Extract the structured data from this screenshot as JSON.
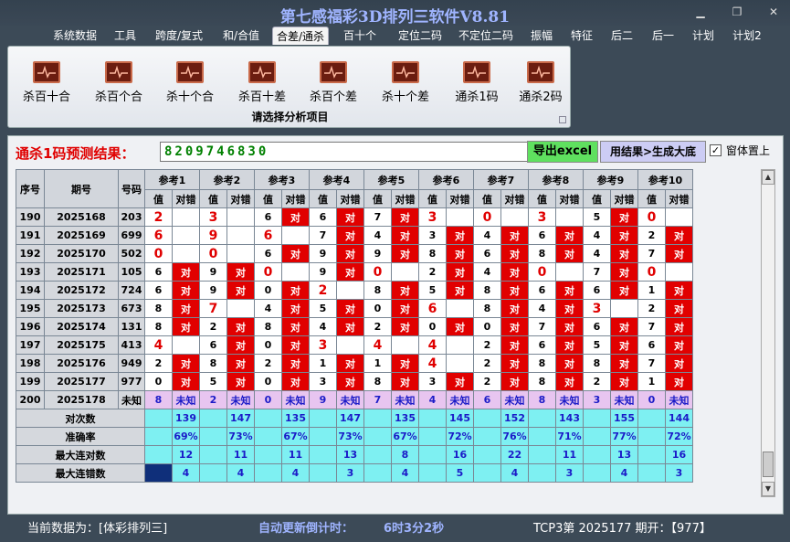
{
  "window": {
    "title": "第七感福彩3D排列三软件V8.81",
    "min": "▁",
    "max": "❐",
    "close": "✕"
  },
  "menu": [
    "系统数据",
    "工具",
    "跨度/复式",
    "和/合值",
    "合差/通杀",
    "百十个",
    "定位二码",
    "不定位二码",
    "振幅",
    "特征",
    "后二",
    "后一",
    "计划",
    "计划2"
  ],
  "menu_active": 4,
  "ribbon": {
    "items": [
      "杀百十合",
      "杀百个合",
      "杀十个合",
      "杀百十差",
      "杀百个差",
      "杀十个差",
      "通杀1码",
      "通杀2码"
    ],
    "caption": "请选择分析项目"
  },
  "prediction": {
    "label": "通杀1码预测结果：",
    "value": "8209746830",
    "excel_button": "导出excel",
    "generate_button": "用结果>生成大底",
    "ontop_label": "窗体置上",
    "ontop_checked": "✓"
  },
  "table": {
    "headers": {
      "seq": "序号",
      "period": "期号",
      "code": "号码",
      "refs": [
        "参考1",
        "参考2",
        "参考3",
        "参考4",
        "参考5",
        "参考6",
        "参考7",
        "参考8",
        "参考9",
        "参考10"
      ],
      "val": "值",
      "check": "对错"
    },
    "rows": [
      {
        "seq": "190",
        "period": "2025168",
        "code": "203",
        "vals": [
          "2",
          "3",
          "6",
          "6",
          "7",
          "3",
          "0",
          "3",
          "5",
          "0"
        ]
      },
      {
        "seq": "191",
        "period": "2025169",
        "code": "699",
        "vals": [
          "6",
          "9",
          "6",
          "7",
          "4",
          "3",
          "4",
          "6",
          "4",
          "2"
        ]
      },
      {
        "seq": "192",
        "period": "2025170",
        "code": "502",
        "vals": [
          "0",
          "0",
          "6",
          "9",
          "9",
          "8",
          "6",
          "8",
          "4",
          "7"
        ]
      },
      {
        "seq": "193",
        "period": "2025171",
        "code": "105",
        "vals": [
          "6",
          "9",
          "0",
          "9",
          "0",
          "2",
          "4",
          "0",
          "7",
          "0"
        ]
      },
      {
        "seq": "194",
        "period": "2025172",
        "code": "724",
        "vals": [
          "6",
          "9",
          "0",
          "2",
          "8",
          "5",
          "8",
          "6",
          "6",
          "1"
        ]
      },
      {
        "seq": "195",
        "period": "2025173",
        "code": "673",
        "vals": [
          "8",
          "7",
          "4",
          "5",
          "0",
          "6",
          "8",
          "4",
          "3",
          "2"
        ]
      },
      {
        "seq": "196",
        "period": "2025174",
        "code": "131",
        "vals": [
          "8",
          "2",
          "8",
          "4",
          "2",
          "0",
          "0",
          "7",
          "6",
          "7"
        ]
      },
      {
        "seq": "197",
        "period": "2025175",
        "code": "413",
        "vals": [
          "4",
          "6",
          "0",
          "3",
          "4",
          "4",
          "2",
          "6",
          "5",
          "6"
        ]
      },
      {
        "seq": "198",
        "period": "2025176",
        "code": "949",
        "vals": [
          "2",
          "8",
          "2",
          "1",
          "1",
          "4",
          "2",
          "8",
          "8",
          "7"
        ]
      },
      {
        "seq": "199",
        "period": "2025177",
        "code": "977",
        "vals": [
          "0",
          "5",
          "0",
          "3",
          "8",
          "3",
          "2",
          "8",
          "2",
          "1"
        ]
      }
    ],
    "pending": {
      "seq": "200",
      "period": "2025178",
      "code": "未知",
      "vals": [
        "8",
        "2",
        "0",
        "9",
        "7",
        "4",
        "6",
        "8",
        "3",
        "0"
      ],
      "check": "未知"
    },
    "marks": {
      "190": [
        "w",
        "w",
        "r",
        "r",
        "r",
        "w",
        "w",
        "w",
        "r",
        "w"
      ],
      "191": [
        "w",
        "w",
        "w",
        "r",
        "r",
        "r",
        "r",
        "r",
        "r",
        "r"
      ],
      "192": [
        "w",
        "w",
        "r",
        "r",
        "r",
        "r",
        "r",
        "r",
        "r",
        "r"
      ],
      "193": [
        "r",
        "r",
        "w",
        "r",
        "w",
        "r",
        "r",
        "w",
        "r",
        "w"
      ],
      "194": [
        "r",
        "r",
        "r",
        "w",
        "r",
        "r",
        "r",
        "r",
        "r",
        "r"
      ],
      "195": [
        "r",
        "w",
        "r",
        "r",
        "r",
        "w",
        "r",
        "r",
        "w",
        "r"
      ],
      "196": [
        "r",
        "r",
        "r",
        "r",
        "r",
        "r",
        "r",
        "r",
        "r",
        "r"
      ],
      "197": [
        "w",
        "r",
        "r",
        "w",
        "w",
        "w",
        "r",
        "r",
        "r",
        "r"
      ],
      "198": [
        "r",
        "r",
        "r",
        "r",
        "r",
        "w",
        "r",
        "r",
        "r",
        "r"
      ],
      "199": [
        "r",
        "r",
        "r",
        "r",
        "r",
        "r",
        "r",
        "r",
        "r",
        "r"
      ]
    },
    "bold": {
      "190": [
        1,
        1,
        0,
        0,
        0,
        1,
        1,
        1,
        0,
        1
      ],
      "191": [
        1,
        1,
        1,
        0,
        0,
        0,
        0,
        0,
        0,
        0
      ],
      "192": [
        1,
        1,
        0,
        0,
        0,
        0,
        0,
        0,
        0,
        0
      ],
      "193": [
        0,
        0,
        1,
        0,
        1,
        0,
        0,
        1,
        0,
        1
      ],
      "194": [
        0,
        0,
        0,
        1,
        0,
        0,
        0,
        0,
        0,
        0
      ],
      "195": [
        0,
        1,
        0,
        0,
        0,
        1,
        0,
        0,
        1,
        0
      ],
      "196": [
        0,
        0,
        0,
        0,
        0,
        0,
        0,
        0,
        0,
        0
      ],
      "197": [
        1,
        0,
        0,
        1,
        1,
        1,
        0,
        0,
        0,
        0
      ],
      "198": [
        0,
        0,
        0,
        0,
        0,
        1,
        0,
        0,
        0,
        0
      ],
      "199": [
        0,
        0,
        0,
        0,
        0,
        0,
        0,
        0,
        0,
        0
      ]
    },
    "summary": [
      {
        "label": "对次数",
        "vals": [
          "139",
          "147",
          "135",
          "147",
          "135",
          "145",
          "152",
          "143",
          "155",
          "144"
        ]
      },
      {
        "label": "准确率",
        "vals": [
          "69%",
          "73%",
          "67%",
          "73%",
          "67%",
          "72%",
          "76%",
          "71%",
          "77%",
          "72%"
        ]
      },
      {
        "label": "最大连对数",
        "vals": [
          "12",
          "11",
          "11",
          "13",
          "8",
          "16",
          "22",
          "11",
          "13",
          "16"
        ]
      },
      {
        "label": "最大连错数",
        "vals": [
          "4",
          "4",
          "4",
          "3",
          "4",
          "5",
          "4",
          "3",
          "4",
          "3"
        ]
      }
    ],
    "check_text": "对"
  },
  "status": {
    "current_data": "当前数据为：[体彩排列三]",
    "countdown_label": "自动更新倒计时：",
    "countdown_value": "6时3分2秒",
    "latest": "TCP3第 2025177 期开：【977】"
  },
  "colors": {
    "hit": "#e10000",
    "title": "#9fb4ff",
    "pending": "#e8c5f0",
    "summary": "#7ef0f2"
  }
}
